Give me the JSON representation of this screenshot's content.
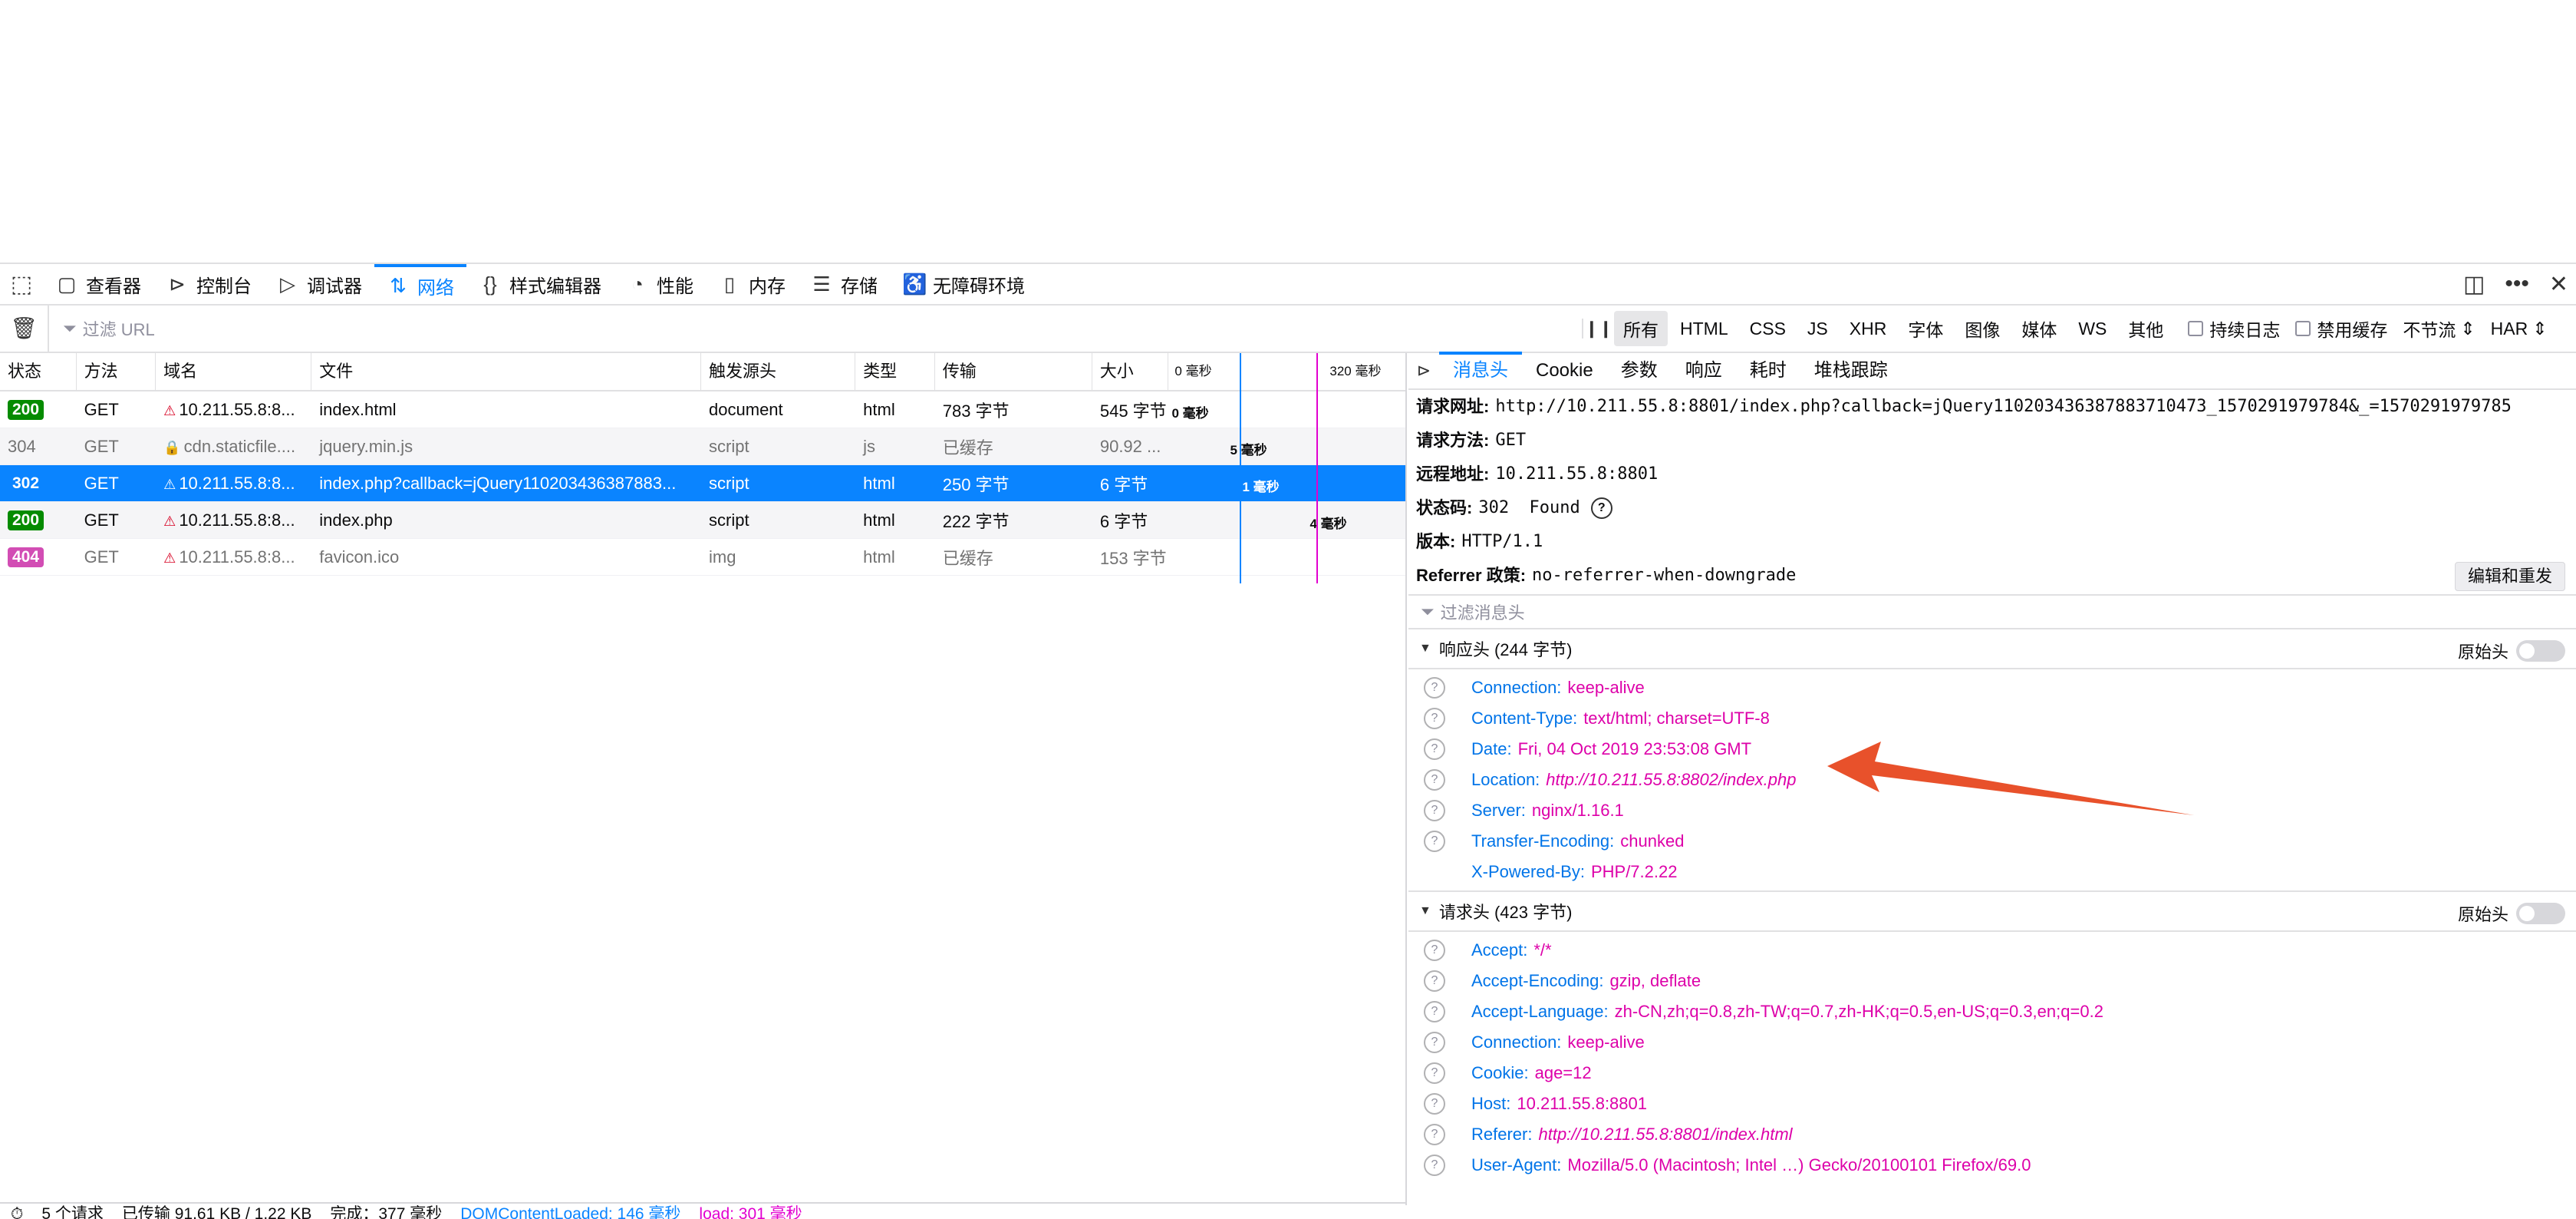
{
  "toolbar": {
    "tabs": [
      {
        "icon": "inspector-icon",
        "glyph": "▢",
        "label": "查看器"
      },
      {
        "icon": "console-icon",
        "glyph": "⊳",
        "label": "控制台"
      },
      {
        "icon": "debugger-icon",
        "glyph": "▷",
        "label": "调试器"
      },
      {
        "icon": "network-icon",
        "glyph": "⇅",
        "label": "网络"
      },
      {
        "icon": "style-editor-icon",
        "glyph": "{}",
        "label": "样式编辑器"
      },
      {
        "icon": "performance-icon",
        "glyph": "◔",
        "label": "性能"
      },
      {
        "icon": "memory-icon",
        "glyph": "▯",
        "label": "内存"
      },
      {
        "icon": "storage-icon",
        "glyph": "☰",
        "label": "存储"
      },
      {
        "icon": "accessibility-icon",
        "glyph": "♿",
        "label": "无障碍环境"
      }
    ]
  },
  "filter": {
    "url_placeholder": "过滤 URL",
    "types": [
      "所有",
      "HTML",
      "CSS",
      "JS",
      "XHR",
      "字体",
      "图像",
      "媒体",
      "WS",
      "其他"
    ],
    "persist_logs": "持续日志",
    "disable_cache": "禁用缓存",
    "throttle": "不节流",
    "har": "HAR"
  },
  "table": {
    "headers": [
      "状态",
      "方法",
      "域名",
      "文件",
      "触发源头",
      "类型",
      "传输",
      "大小",
      "0 毫秒",
      "320 毫秒"
    ],
    "rows": [
      {
        "status": "200",
        "method": "GET",
        "domain": "10.211.55.8:8...",
        "file": "index.html",
        "cause": "document",
        "type": "html",
        "transferred": "783 字节",
        "size": "545 字节",
        "timing": "0 毫秒"
      },
      {
        "status": "304",
        "method": "GET",
        "domain": "cdn.staticfile....",
        "file": "jquery.min.js",
        "cause": "script",
        "type": "js",
        "transferred": "已缓存",
        "size": "90.92 ...",
        "timing": "5 毫秒"
      },
      {
        "status": "302",
        "method": "GET",
        "domain": "10.211.55.8:8...",
        "file": "index.php?callback=jQuery110203436387883...",
        "cause": "script",
        "type": "html",
        "transferred": "250 字节",
        "size": "6 字节",
        "timing": "1 毫秒"
      },
      {
        "status": "200",
        "method": "GET",
        "domain": "10.211.55.8:8...",
        "file": "index.php",
        "cause": "script",
        "type": "html",
        "transferred": "222 字节",
        "size": "6 字节",
        "timing": "4 毫秒"
      },
      {
        "status": "404",
        "method": "GET",
        "domain": "10.211.55.8:8...",
        "file": "favicon.ico",
        "cause": "img",
        "type": "html",
        "transferred": "已缓存",
        "size": "153 字节",
        "timing": ""
      }
    ],
    "status_colors": {
      "200": "#058b00",
      "304": "#737373",
      "302": "#0074e8",
      "404": "#d24db4"
    }
  },
  "footer": {
    "requests": "5 个请求",
    "transferred": "已传输 91.61 KB / 1.22 KB",
    "finish": "完成：377 毫秒",
    "dom_loaded": "DOMContentLoaded: 146 毫秒",
    "load": "load: 301 毫秒"
  },
  "detail": {
    "tabs": [
      "消息头",
      "Cookie",
      "参数",
      "响应",
      "耗时",
      "堆栈跟踪"
    ],
    "request_url_label": "请求网址:",
    "request_url": "http://10.211.55.8:8801/index.php?callback=jQuery110203436387883710473_1570291979784&_=1570291979785",
    "method_label": "请求方法:",
    "method": "GET",
    "remote_label": "远程地址:",
    "remote": "10.211.55.8:8801",
    "status_label": "状态码:",
    "status": "302  Found",
    "version_label": "版本:",
    "version": "HTTP/1.1",
    "referrer_label": "Referrer 政策:",
    "referrer": "no-referrer-when-downgrade",
    "resend": "编辑和重发",
    "filter_placeholder": "过滤消息头",
    "raw_label": "原始头",
    "response_section": "响应头 (244 字节)",
    "request_section": "请求头 (423 字节)",
    "response_headers": [
      {
        "k": "Connection:",
        "v": "keep-alive"
      },
      {
        "k": "Content-Type:",
        "v": "text/html; charset=UTF-8"
      },
      {
        "k": "Date:",
        "v": "Fri, 04 Oct 2019 23:53:08 GMT"
      },
      {
        "k": "Location:",
        "v": "http://10.211.55.8:8802/index.php"
      },
      {
        "k": "Server:",
        "v": "nginx/1.16.1"
      },
      {
        "k": "Transfer-Encoding:",
        "v": "chunked"
      },
      {
        "k": "X-Powered-By:",
        "v": "PHP/7.2.22"
      }
    ],
    "request_headers": [
      {
        "k": "Accept:",
        "v": "*/*"
      },
      {
        "k": "Accept-Encoding:",
        "v": "gzip, deflate"
      },
      {
        "k": "Accept-Language:",
        "v": "zh-CN,zh;q=0.8,zh-TW;q=0.7,zh-HK;q=0.5,en-US;q=0.3,en;q=0.2"
      },
      {
        "k": "Connection:",
        "v": "keep-alive"
      },
      {
        "k": "Cookie:",
        "v": "age=12"
      },
      {
        "k": "Host:",
        "v": "10.211.55.8:8801"
      },
      {
        "k": "Referer:",
        "v": "http://10.211.55.8:8801/index.html"
      },
      {
        "k": "User-Agent:",
        "v": "Mozilla/5.0 (Macintosh; Intel …) Gecko/20100101 Firefox/69.0"
      }
    ]
  },
  "annotation": {
    "arrow_color": "#e8512b"
  }
}
